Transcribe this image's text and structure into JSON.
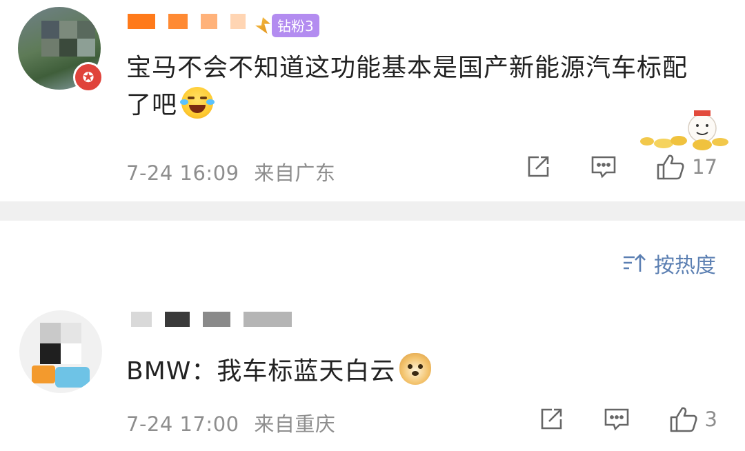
{
  "comments": [
    {
      "username": "",
      "fan_badge": "钻粉3",
      "text": "宝马不会不知道这功能基本是国产新能源汽车标配了吧",
      "emoji": "laughing-tears-emoji",
      "timestamp": "7-24 16:09",
      "location": "来自广东",
      "likes": "17"
    },
    {
      "username": "",
      "text": "BMW：我车标蓝天白云",
      "emoji": "doge-emoji",
      "timestamp": "7-24 17:00",
      "location": "来自重庆",
      "likes": "3"
    }
  ],
  "sort": {
    "label": "按热度"
  },
  "colors": {
    "link_blue": "#5b7fb2",
    "meta_gray": "#8e8e8e",
    "fan_badge_purple": "#b38cf0",
    "divider": "#f0f0f0"
  },
  "icons": [
    "share-icon",
    "comment-icon",
    "like-icon",
    "sort-icon"
  ]
}
